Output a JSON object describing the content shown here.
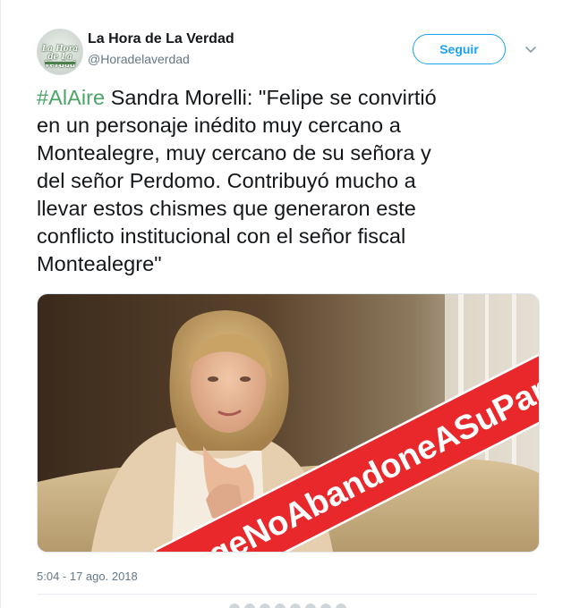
{
  "account": {
    "name": "La Hora de La Verdad",
    "handle": "@Horadelaverdad",
    "avatar_logo_text": "La Hora de La Verdad",
    "avatar_icon": "logo-avatar"
  },
  "actions": {
    "follow_label": "Seguir",
    "more_icon": "chevron-down-icon"
  },
  "tweet": {
    "hashtag": "#AlAire",
    "lines": [
      " Sandra Morelli: \"Felipe se convirtió",
      "en un personaje inédito muy cercano a",
      "Montealegre, muy cercano de su señora y",
      "del señor Perdomo. Contribuyó mucho a",
      "llevar estos chismes que generaron este",
      "conflicto institucional con el señor fiscal",
      "Montealegre\""
    ],
    "timestamp": "5:04 - 17 ago. 2018"
  },
  "media": {
    "banner_text": "#DuqeNoAbandoneASuPartido",
    "banner_color": "#e8282b"
  },
  "colors": {
    "accent": "#1da1f2",
    "hashtag": "#4aa564",
    "text": "#14171a",
    "muted": "#657786"
  }
}
